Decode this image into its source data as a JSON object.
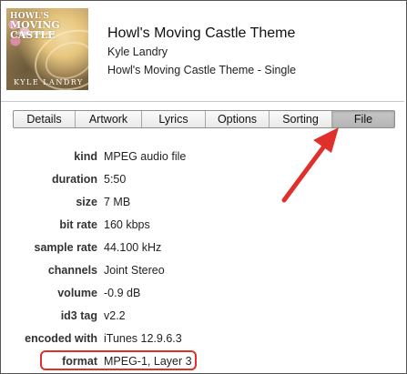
{
  "header": {
    "artwork": {
      "line1": "HOWL'S",
      "line2": "MOVING CASTLE",
      "line3": "classical solo piano",
      "line4": "KYLE LANDRY"
    },
    "title": "Howl's Moving Castle Theme",
    "artist": "Kyle Landry",
    "album": "Howl's Moving Castle Theme - Single"
  },
  "tabs": [
    {
      "label": "Details",
      "active": false
    },
    {
      "label": "Artwork",
      "active": false
    },
    {
      "label": "Lyrics",
      "active": false
    },
    {
      "label": "Options",
      "active": false
    },
    {
      "label": "Sorting",
      "active": false
    },
    {
      "label": "File",
      "active": true
    }
  ],
  "file_info": [
    {
      "label": "kind",
      "value": "MPEG audio file"
    },
    {
      "label": "duration",
      "value": "5:50"
    },
    {
      "label": "size",
      "value": "7 MB"
    },
    {
      "label": "bit rate",
      "value": "160 kbps"
    },
    {
      "label": "sample rate",
      "value": "44.100 kHz"
    },
    {
      "label": "channels",
      "value": "Joint Stereo"
    },
    {
      "label": "volume",
      "value": "-0.9 dB"
    },
    {
      "label": "id3 tag",
      "value": "v2.2"
    },
    {
      "label": "encoded with",
      "value": "iTunes 12.9.6.3"
    },
    {
      "label": "format",
      "value": "MPEG-1, Layer 3"
    }
  ],
  "annotation_color": "#e0302b"
}
